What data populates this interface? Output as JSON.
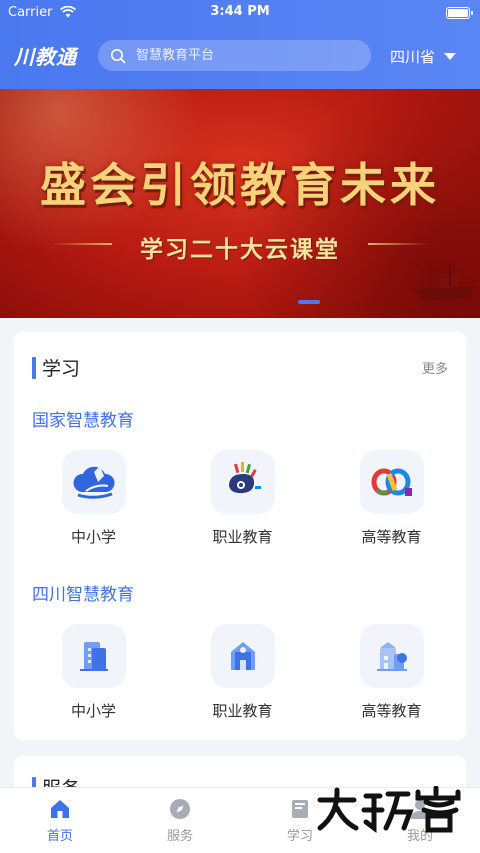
{
  "status_bar": {
    "carrier": "Carrier",
    "time": "3:44 PM"
  },
  "header": {
    "logo": "川教通",
    "search_placeholder": "智慧教育平台",
    "region": "四川省"
  },
  "banner": {
    "title": "盛会引领教育未来",
    "subtitle": "学习二十大云课堂",
    "slide_index": 1
  },
  "learning": {
    "title": "学习",
    "more": "更多",
    "national": {
      "title": "国家智慧教育",
      "items": [
        {
          "label": "中小学",
          "icon": "cloud-book-icon"
        },
        {
          "label": "职业教育",
          "icon": "palette-icon"
        },
        {
          "label": "高等教育",
          "icon": "infinity-icon"
        }
      ]
    },
    "sichuan": {
      "title": "四川智慧教育",
      "items": [
        {
          "label": "中小学",
          "icon": "building-icon"
        },
        {
          "label": "职业教育",
          "icon": "school-icon"
        },
        {
          "label": "高等教育",
          "icon": "campus-icon"
        }
      ]
    }
  },
  "services": {
    "title": "服务"
  },
  "tabs": [
    {
      "label": "首页",
      "icon": "home-icon",
      "active": true
    },
    {
      "label": "服务",
      "icon": "compass-icon",
      "active": false
    },
    {
      "label": "学习",
      "icon": "book-icon",
      "active": false
    },
    {
      "label": "我的",
      "icon": "user-icon",
      "active": false
    }
  ],
  "colors": {
    "primary": "#4A78EF",
    "banner_red": "#B81B12",
    "gold": "#F6D37A"
  }
}
